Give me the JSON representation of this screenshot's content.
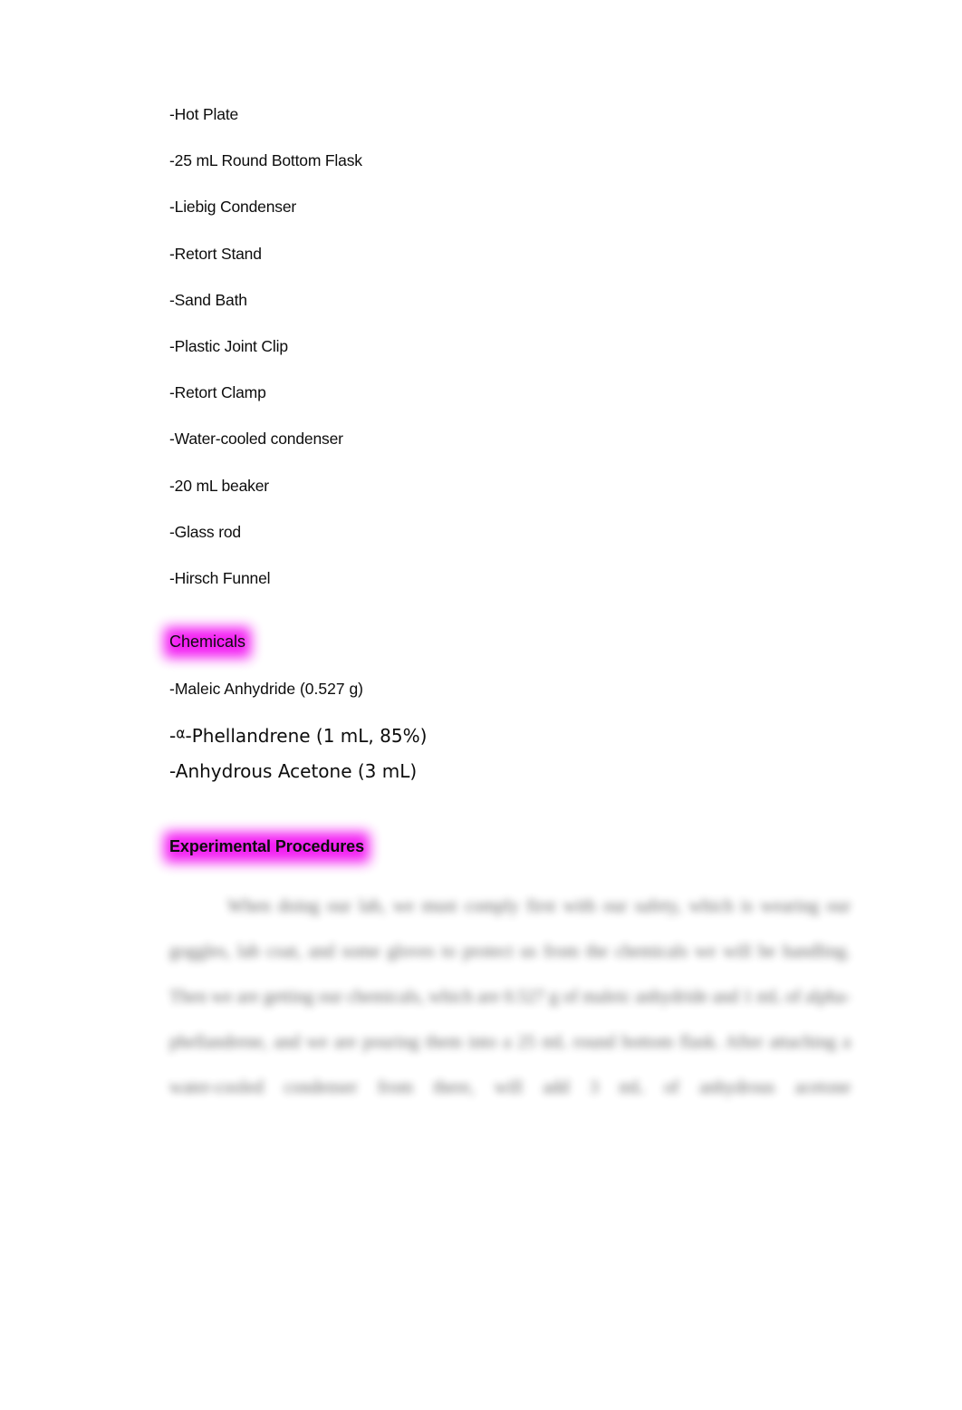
{
  "document": {
    "background_color": "#ffffff",
    "text_color": "#0d0d0d",
    "highlight_color": "#f215f2"
  },
  "equipment": {
    "items": [
      "-Hot Plate",
      "-25 mL Round Bottom Flask",
      "-Liebig Condenser",
      "-Retort Stand",
      "-Sand Bath",
      "-Plastic Joint Clip",
      "-Retort Clamp",
      "-Water-cooled condenser",
      "-20 mL beaker",
      "-Glass rod",
      "-Hirsch Funnel"
    ]
  },
  "chemicals_section": {
    "heading": "Chemicals",
    "items": [
      {
        "prefix": "-Maleic Anhydride (0.527 g)",
        "symbol": "",
        "suffix": ""
      },
      {
        "prefix": "-",
        "symbol": "α",
        "suffix": "-Phellandrene (1 mL, 85%)"
      },
      {
        "prefix": "-Anhydrous Acetone (3 mL)",
        "symbol": "",
        "suffix": ""
      }
    ]
  },
  "procedures_section": {
    "heading": "Experimental Procedures",
    "paragraph_lines": [
      "When doing our lab, we must comply first with our safety, which is wearing our",
      "goggles, lab coat, and some gloves to protect us from the chemicals we will be handling.",
      "Then we are getting our chemicals, which are 0.527 g of maleic anhydride and 1 mL of",
      "alpha-phellandrene, and we are pouring them into a 25 mL round bottom flask. After",
      "attaching a water-cooled condenser from there, will add 3 mL of anhydrous acetone"
    ]
  }
}
